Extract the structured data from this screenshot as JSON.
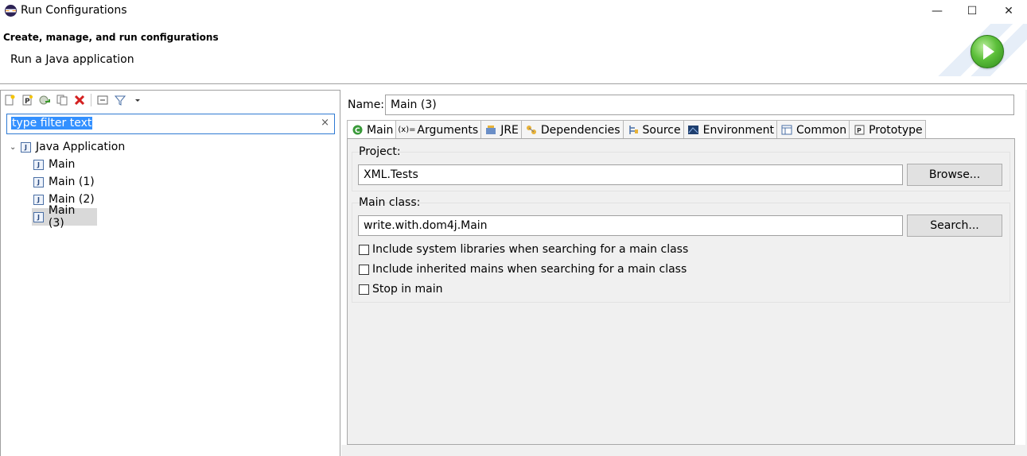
{
  "window": {
    "title": "Run Configurations",
    "controls": {
      "minimize": "—",
      "maximize": "☐",
      "close": "✕"
    }
  },
  "header": {
    "title": "Create, manage, and run configurations",
    "subtitle": "Run a Java application",
    "icon": "run-play-icon"
  },
  "left": {
    "toolbar_icons": [
      "new-config-icon",
      "new-prototype-icon",
      "export-icon",
      "duplicate-icon",
      "delete-icon",
      "collapse-all-icon",
      "filter-icon",
      "view-menu-icon"
    ],
    "filter": {
      "value": "type filter text",
      "clear": "×"
    },
    "tree": {
      "category": "Java Application",
      "items": [
        "Main",
        "Main (1)",
        "Main (2)",
        "Main (3)"
      ],
      "selected_index": 3
    }
  },
  "right": {
    "name_label": "Name:",
    "name_value": "Main (3)",
    "tabs": [
      {
        "label": "Main",
        "icon": "main-class-icon"
      },
      {
        "label": "Arguments",
        "icon": "arguments-icon"
      },
      {
        "label": "JRE",
        "icon": "jre-icon"
      },
      {
        "label": "Dependencies",
        "icon": "dependencies-icon"
      },
      {
        "label": "Source",
        "icon": "source-icon"
      },
      {
        "label": "Environment",
        "icon": "environment-icon"
      },
      {
        "label": "Common",
        "icon": "common-icon"
      },
      {
        "label": "Prototype",
        "icon": "prototype-icon"
      }
    ],
    "active_tab": "Main",
    "project": {
      "label": "Project:",
      "value": "XML.Tests",
      "button": "Browse..."
    },
    "main_class": {
      "label": "Main class:",
      "value": "write.with.dom4j.Main",
      "button": "Search...",
      "options": [
        {
          "label": "Include system libraries when searching for a main class",
          "checked": false
        },
        {
          "label": "Include inherited mains when searching for a main class",
          "checked": false
        },
        {
          "label": "Stop in main",
          "checked": false
        }
      ]
    }
  }
}
